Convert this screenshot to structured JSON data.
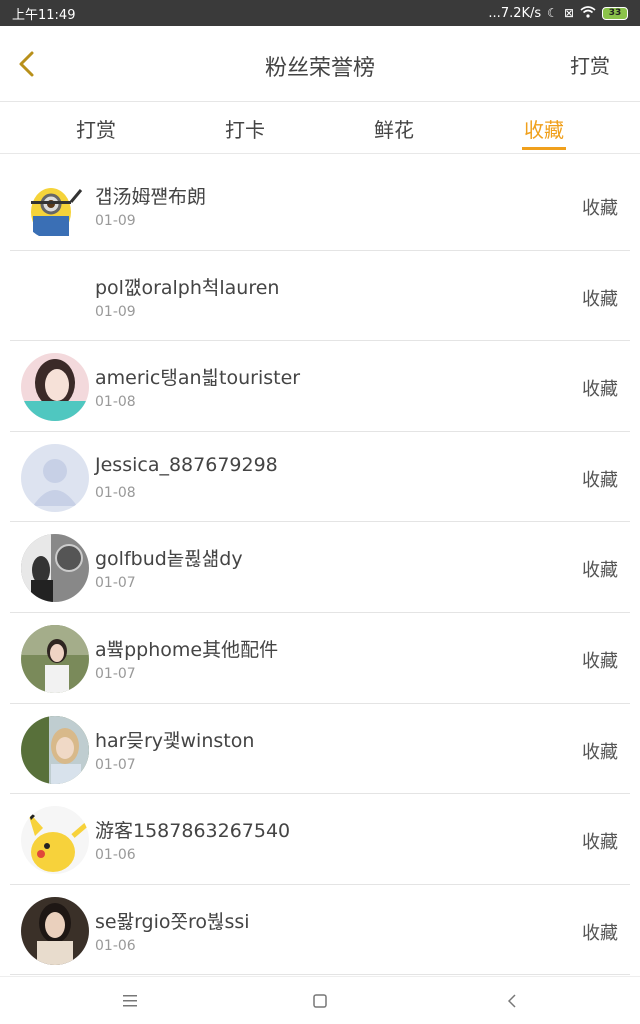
{
  "status": {
    "time": "上午11:49",
    "network": "...7.2K/s",
    "battery": "33"
  },
  "header": {
    "title": "粉丝荣誉榜",
    "action": "打赏"
  },
  "tabs": [
    {
      "label": "打赏"
    },
    {
      "label": "打卡"
    },
    {
      "label": "鲜花"
    },
    {
      "label": "收藏"
    }
  ],
  "active_tab": "收藏",
  "colors": {
    "accent": "#f0a01c",
    "status_bar": "#3a3a3a"
  },
  "rows": [
    {
      "name": "걥汤姆쨷布朗",
      "date": "01-09",
      "type": "收藏",
      "avatar": "minion"
    },
    {
      "name": "pol꺲oralph척lauren",
      "date": "01-09",
      "type": "收藏",
      "avatar": "none"
    },
    {
      "name": "americ탱an븳tourister",
      "date": "01-08",
      "type": "收藏",
      "avatar": "girl-teal"
    },
    {
      "name": "Jessica_887679298",
      "date": "01-08",
      "type": "收藏",
      "avatar": "default-user"
    },
    {
      "name": "golfbud놑퓒섊dy",
      "date": "01-07",
      "type": "收藏",
      "avatar": "bw-photo"
    },
    {
      "name": "a쁔pphome其他配件",
      "date": "01-07",
      "type": "收藏",
      "avatar": "girl-garden"
    },
    {
      "name": "har믖ry괯winston",
      "date": "01-07",
      "type": "收藏",
      "avatar": "girl-blonde"
    },
    {
      "name": "游客1587863267540",
      "date": "01-06",
      "type": "收藏",
      "avatar": "pikachu"
    },
    {
      "name": "se뫓rgio쫏ro붢ssi",
      "date": "01-06",
      "type": "收藏",
      "avatar": "girl-dark"
    }
  ]
}
